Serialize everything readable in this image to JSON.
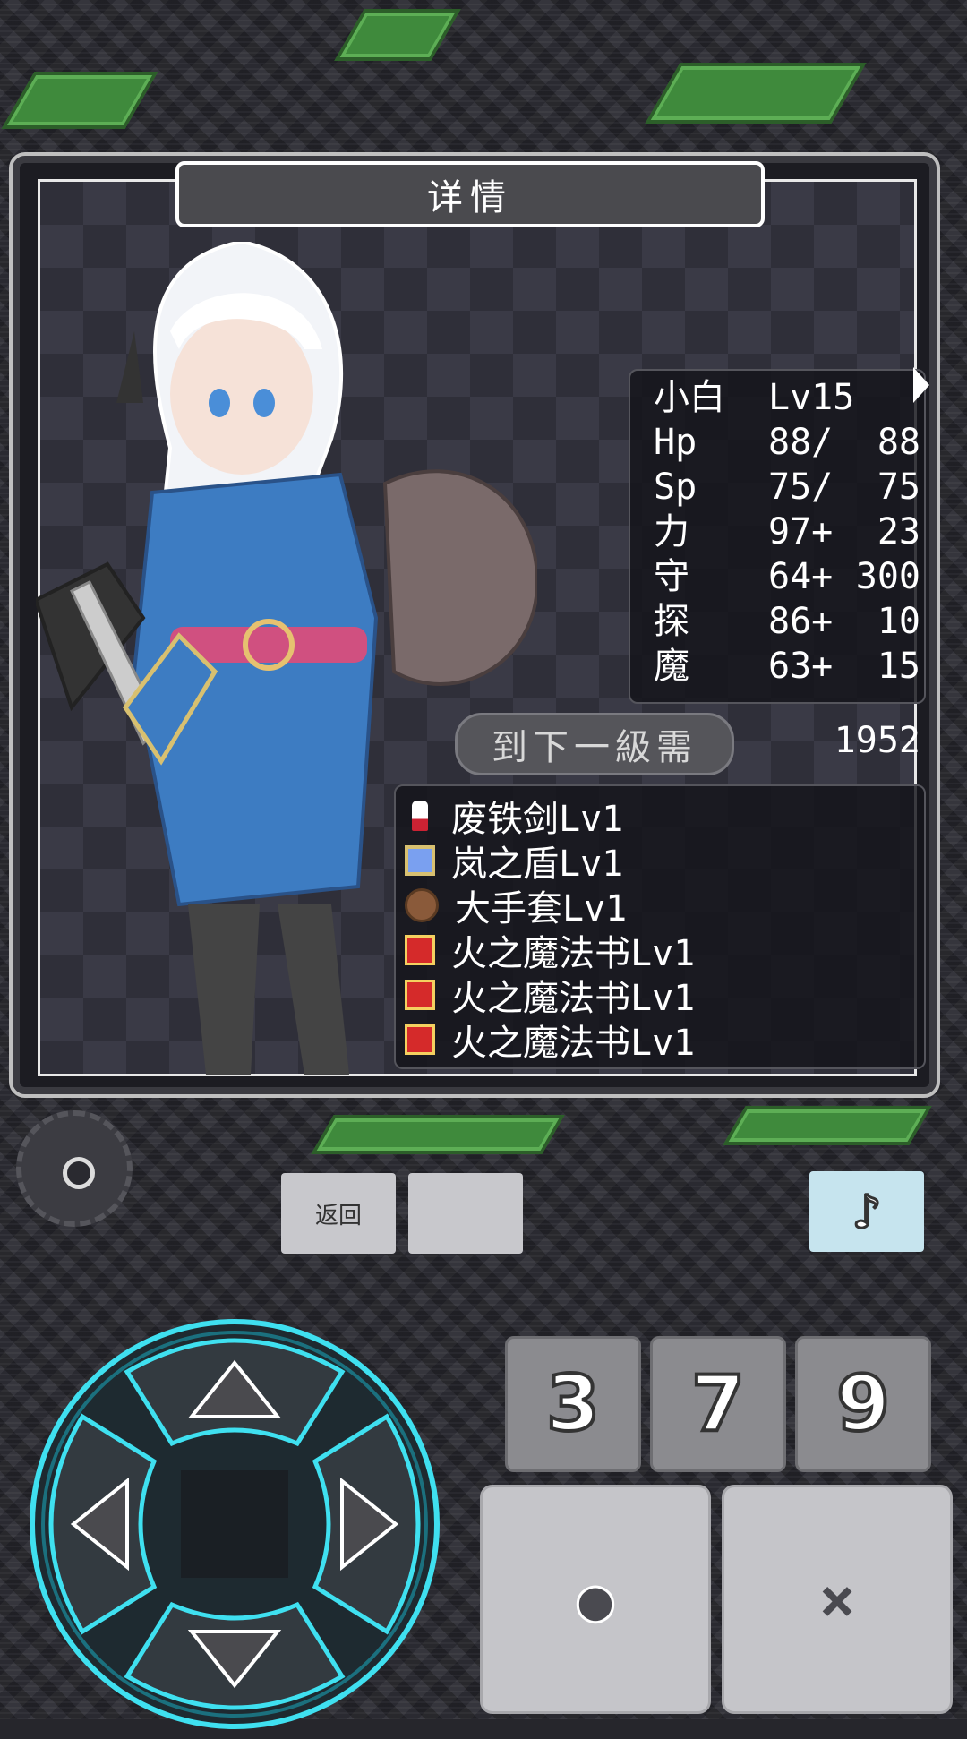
{
  "window": {
    "title": "详情"
  },
  "stats": {
    "rows": [
      {
        "a": "小白",
        "b": "Lv15",
        "c": ""
      },
      {
        "a": "Hp",
        "b": "88/",
        "c": "88"
      },
      {
        "a": "Sp",
        "b": "75/",
        "c": "75"
      },
      {
        "a": "力",
        "b": "97+",
        "c": "23"
      },
      {
        "a": "守",
        "b": "64+",
        "c": "300"
      },
      {
        "a": "探",
        "b": "86+",
        "c": "10"
      },
      {
        "a": "魔",
        "b": "63+",
        "c": "15"
      }
    ]
  },
  "next_level": {
    "label": "到下一級需",
    "value": "1952"
  },
  "equipment": [
    {
      "icon": "sword-icon",
      "name": "废铁剑Lv1"
    },
    {
      "icon": "shield-icon",
      "name": "岚之盾Lv1"
    },
    {
      "icon": "glove-icon",
      "name": "大手套Lv1"
    },
    {
      "icon": "book-icon",
      "name": "火之魔法书Lv1"
    },
    {
      "icon": "book-icon",
      "name": "火之魔法书Lv1"
    },
    {
      "icon": "book-icon",
      "name": "火之魔法书Lv1"
    }
  ],
  "controls": {
    "back_label": "返回",
    "blank_label": "",
    "music_glyph": "♪",
    "num_buttons": [
      "3",
      "7",
      "9"
    ],
    "confirm_glyph": "●",
    "cancel_glyph": "✕"
  },
  "colors": {
    "dpad_glow": "#3fe0f0",
    "music_bg": "#c6e4ee",
    "panel_border": "#bfbfbf"
  }
}
